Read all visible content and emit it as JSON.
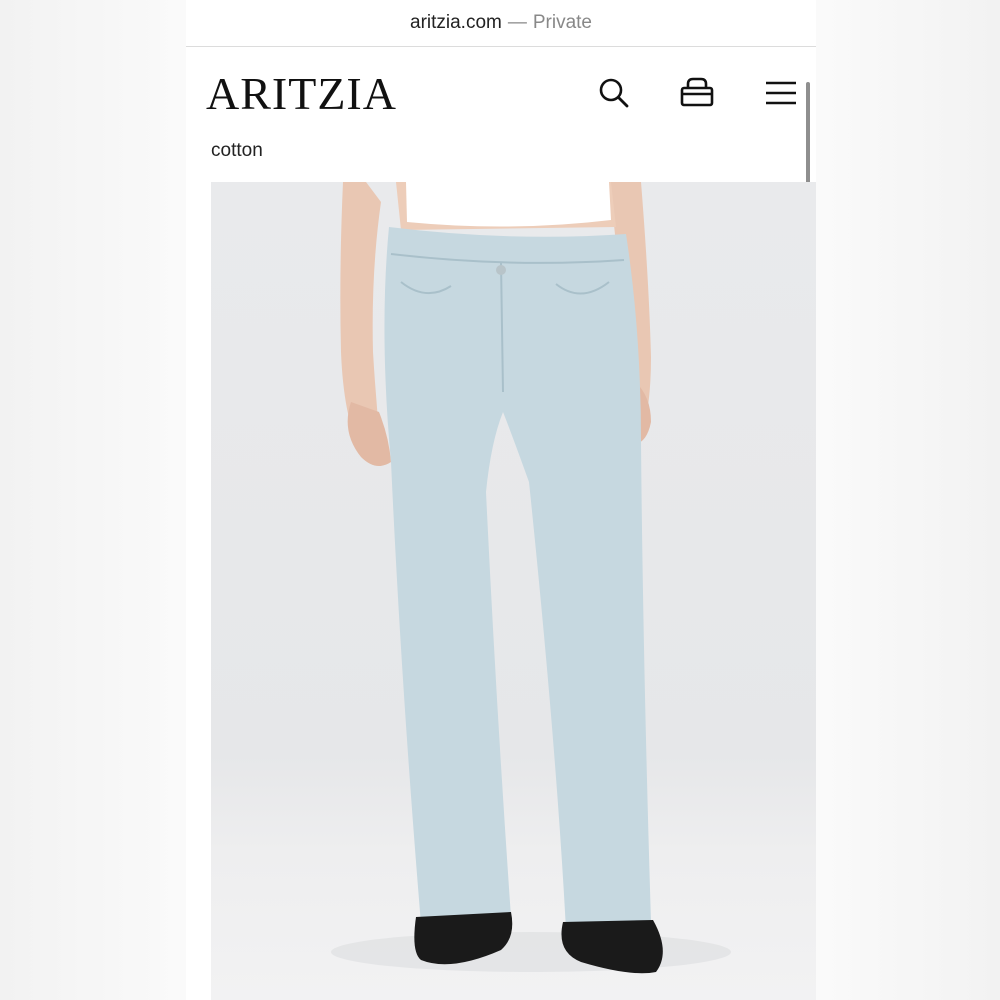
{
  "browser": {
    "url": "aritzia.com",
    "separator": "—",
    "mode": "Private"
  },
  "header": {
    "logo": "ARITZIA",
    "breadcrumb": "cotton",
    "icons": [
      "search-icon",
      "bag-icon",
      "menu-icon"
    ]
  },
  "product": {
    "image": "model-wearing-light-wash-jeans",
    "denim_color": "#c6d8e0",
    "shoe_color": "#1a1a1a",
    "top_color": "#ffffff"
  }
}
